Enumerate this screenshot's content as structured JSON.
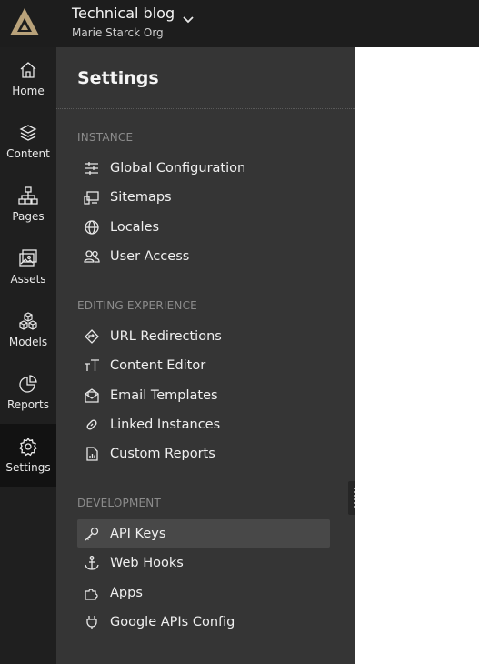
{
  "header": {
    "project_title": "Technical blog",
    "project_org": "Marie Starck Org"
  },
  "rail": {
    "items": [
      {
        "label": "Home",
        "icon": "home-icon"
      },
      {
        "label": "Content",
        "icon": "layers-icon"
      },
      {
        "label": "Pages",
        "icon": "sitemap-icon"
      },
      {
        "label": "Assets",
        "icon": "images-icon"
      },
      {
        "label": "Models",
        "icon": "cubes-icon"
      },
      {
        "label": "Reports",
        "icon": "pie-chart-icon"
      },
      {
        "label": "Settings",
        "icon": "gear-icon",
        "active": true
      }
    ]
  },
  "settings": {
    "title": "Settings",
    "sections": [
      {
        "heading": "INSTANCE",
        "items": [
          {
            "label": "Global Configuration",
            "icon": "sliders-icon"
          },
          {
            "label": "Sitemaps",
            "icon": "devices-icon"
          },
          {
            "label": "Locales",
            "icon": "globe-icon"
          },
          {
            "label": "User Access",
            "icon": "users-icon"
          }
        ]
      },
      {
        "heading": "EDITING EXPERIENCE",
        "items": [
          {
            "label": "URL Redirections",
            "icon": "redirect-icon"
          },
          {
            "label": "Content Editor",
            "icon": "text-size-icon"
          },
          {
            "label": "Email Templates",
            "icon": "envelope-open-icon"
          },
          {
            "label": "Linked Instances",
            "icon": "link-icon"
          },
          {
            "label": "Custom Reports",
            "icon": "file-chart-icon"
          }
        ]
      },
      {
        "heading": "DEVELOPMENT",
        "items": [
          {
            "label": "API Keys",
            "icon": "key-icon",
            "selected": true
          },
          {
            "label": "Web Hooks",
            "icon": "anchor-icon"
          },
          {
            "label": "Apps",
            "icon": "puzzle-icon"
          },
          {
            "label": "Google APIs Config",
            "icon": "plug-icon"
          }
        ]
      }
    ]
  },
  "colors": {
    "topbar_bg": "#1d1d1d",
    "rail_bg": "#1f1f1f",
    "rail_active_bg": "#121212",
    "panel_bg": "#353535",
    "selected_item_bg": "#484848",
    "logo_accent": "#b9a27a",
    "content_bg": "#ffffff"
  }
}
